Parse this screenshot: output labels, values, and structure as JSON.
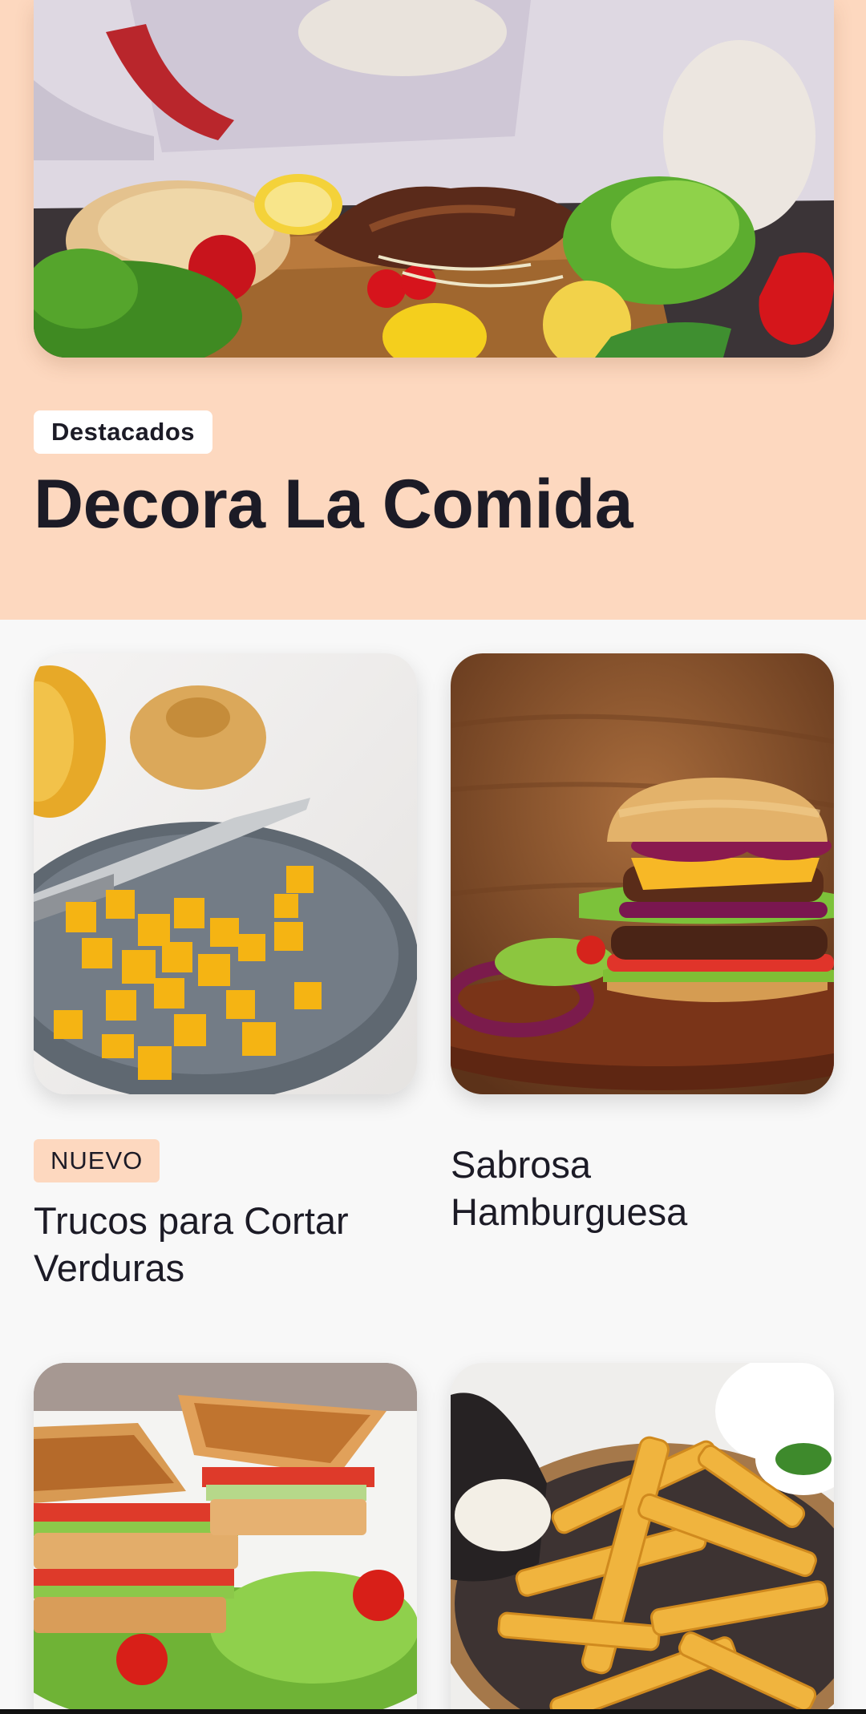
{
  "featured": {
    "badge": "Destacados",
    "title": "Decora La Comida",
    "image_alt": "chef-plating-steak-image"
  },
  "cards": [
    {
      "badge": "NUEVO",
      "title": "Trucos para Cortar Verduras",
      "image": "diced-squash-plate-image"
    },
    {
      "badge": "",
      "title": "Sabrosa Hamburguesa",
      "image": "burger-image"
    },
    {
      "badge": "",
      "title": "",
      "image": "club-sandwich-image"
    },
    {
      "badge": "",
      "title": "",
      "image": "french-fries-basket-image"
    }
  ],
  "colors": {
    "featured_bg": "#fdd8bf",
    "badge_new_bg": "#fdd8bf",
    "text": "#1c1b26",
    "page_bg": "#f8f8f8"
  }
}
